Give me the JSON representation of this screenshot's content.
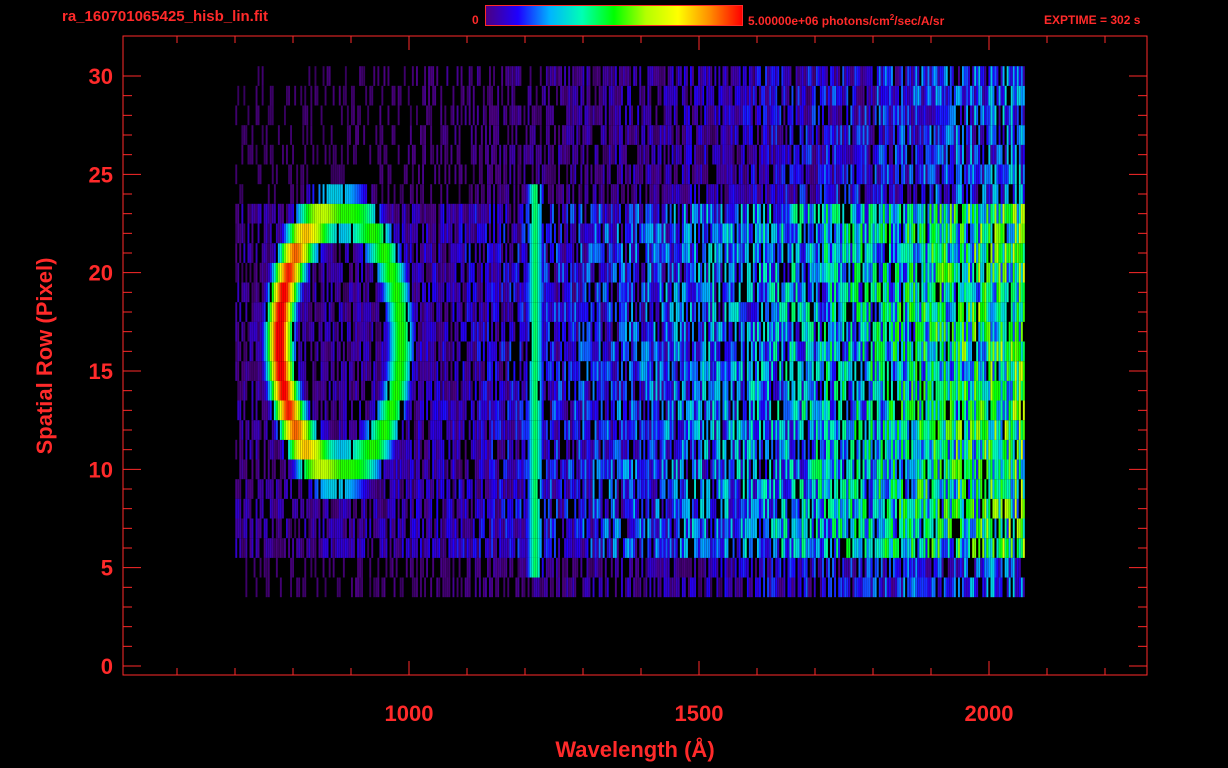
{
  "header": {
    "filename": "ra_160701065425_hisb_lin.fit",
    "colorbar_min": "0",
    "colorbar_max": "5.00000e+06",
    "units_pre": "photons/cm",
    "units_sup": "2",
    "units_post": "/sec/A/sr",
    "exptime": "EXPTIME = 302 s"
  },
  "colors": {
    "text": "#ff2a2a",
    "axes": "#ff2a2a",
    "background": "#000000",
    "colormap": [
      "#000000",
      "#4b0082",
      "#1e00ff",
      "#00b4ff",
      "#00ffb4",
      "#00ff00",
      "#b4ff00",
      "#ffff00",
      "#ff8c00",
      "#ff0000"
    ]
  },
  "chart_data": {
    "type": "heatmap",
    "title": "ra_160701065425_hisb_lin.fit",
    "xlabel": "Wavelength (Å)",
    "ylabel": "Spatial Row (Pixel)",
    "xlim": [
      905,
      2245
    ],
    "ylim": [
      0,
      30
    ],
    "xticks": [
      1000,
      1500,
      2000
    ],
    "yticks": [
      0,
      5,
      10,
      15,
      20,
      25,
      30
    ],
    "colorbar_range": [
      0,
      5000000
    ],
    "colorbar_units": "photons/cm^2/sec/A/sr",
    "features": [
      {
        "name": "ring",
        "wavelength_center": 880,
        "row_center": 16.5,
        "note": "bright elliptical emission, peak on left side"
      },
      {
        "name": "line",
        "wavelength": 1216,
        "row_range": [
          5,
          24
        ]
      },
      {
        "name": "continuum",
        "wavelength_range": [
          1250,
          2060
        ],
        "row_range": [
          6,
          23
        ],
        "rising_to_red": true
      }
    ]
  }
}
